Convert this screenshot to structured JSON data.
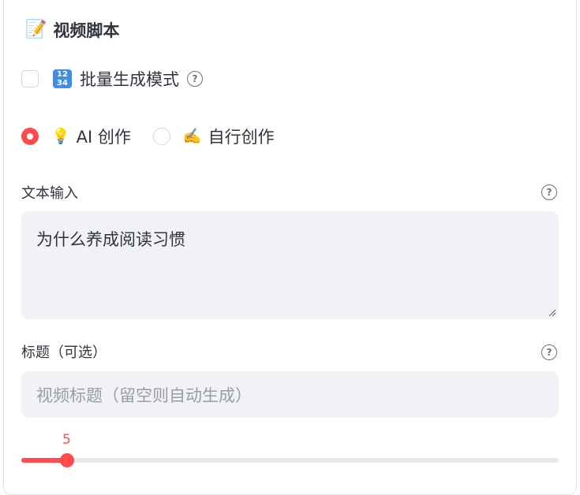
{
  "header": {
    "icon": "memo-icon",
    "icon_glyph": "📝",
    "title": "视频脚本"
  },
  "batch_mode": {
    "checked": false,
    "emoji_name": "input-numbers-icon",
    "emoji_top": "12",
    "emoji_bottom": "34",
    "label": "批量生成模式",
    "help_glyph": "?"
  },
  "script_source": {
    "options": [
      {
        "emoji": "💡",
        "icon": "light-bulb-icon",
        "label": "AI 创作",
        "selected": true
      },
      {
        "emoji": "✍️",
        "icon": "writing-hand-icon",
        "label": "自行创作",
        "selected": false
      }
    ]
  },
  "text_input": {
    "label": "文本输入",
    "value": "为什么养成阅读习惯",
    "help_glyph": "?"
  },
  "title_input": {
    "label": "标题（可选）",
    "placeholder": "视频标题（留空则自动生成）",
    "help_glyph": "?"
  },
  "slider": {
    "value": "5",
    "fraction": 0.085
  },
  "colors": {
    "accent": "#ff4b4b",
    "input_bg": "#f0f2f6",
    "text": "#31333f"
  }
}
